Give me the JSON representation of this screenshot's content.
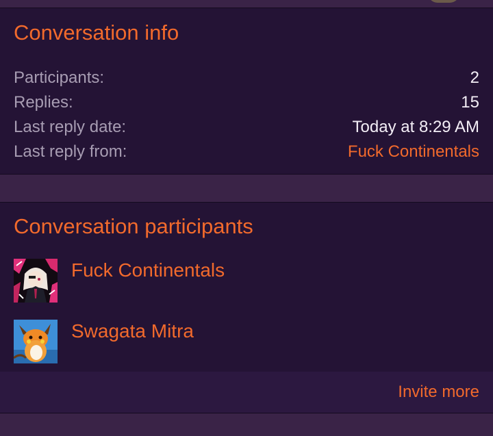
{
  "conversation_info": {
    "title": "Conversation info",
    "rows": [
      {
        "label": "Participants:",
        "value": "2"
      },
      {
        "label": "Replies:",
        "value": "15"
      },
      {
        "label": "Last reply date:",
        "value": "Today at 8:29 AM"
      },
      {
        "label": "Last reply from:",
        "value": "Fuck Continentals"
      }
    ]
  },
  "conversation_participants": {
    "title": "Conversation participants",
    "members": [
      {
        "name": "Fuck Continentals",
        "avatar": "anime-character-avatar"
      },
      {
        "name": "Swagata Mitra",
        "avatar": "raichu-avatar"
      }
    ]
  },
  "footer": {
    "invite_label": "Invite more"
  },
  "colors": {
    "accent": "#f26a2c",
    "panel": "#241335",
    "background": "#3a2347",
    "muted_text": "#a89db3",
    "text": "#f3eef6"
  }
}
